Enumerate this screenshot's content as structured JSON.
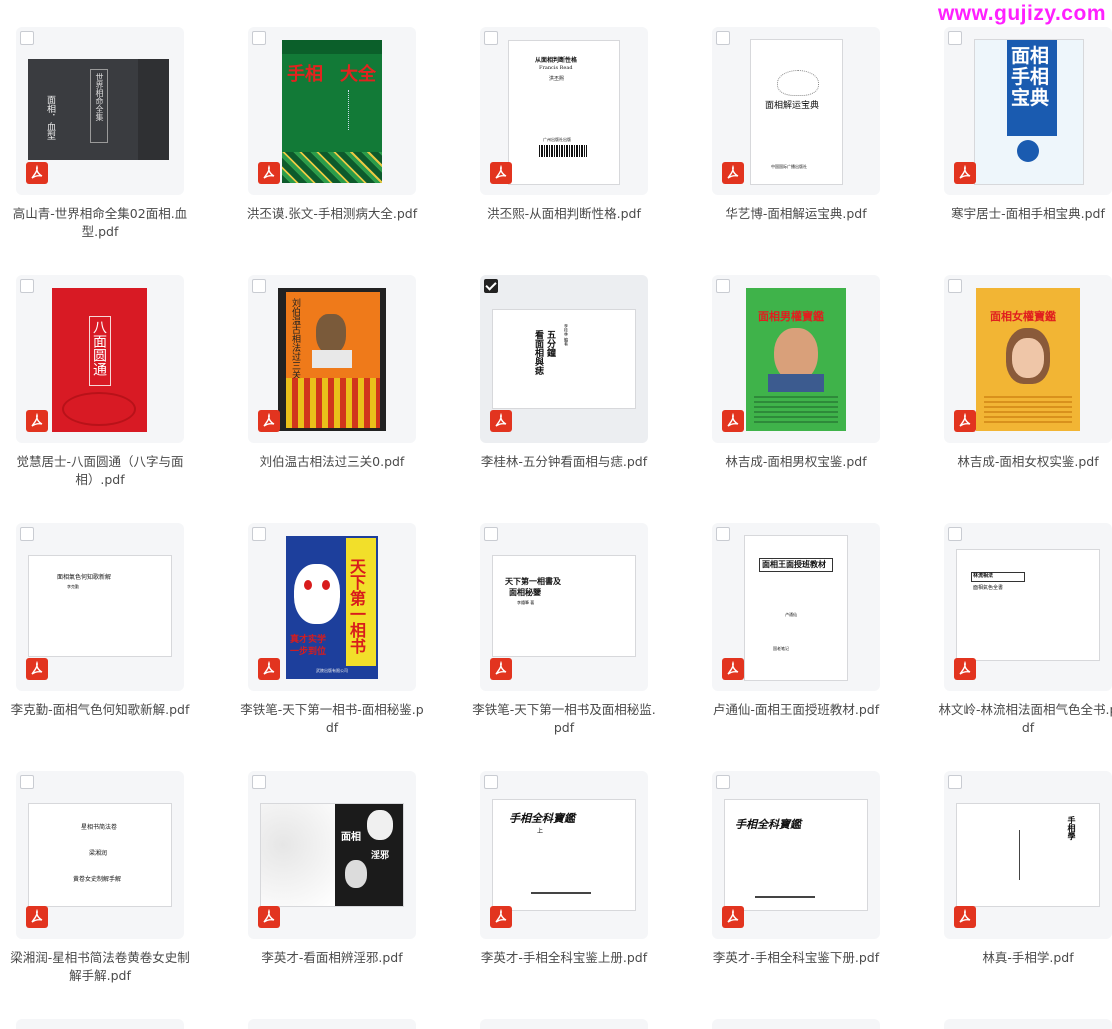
{
  "watermark": "www.gujizy.com",
  "files": [
    {
      "name": "高山青-世界相命全集02面相.血型.pdf",
      "selected": false
    },
    {
      "name": "洪丕谟.张文-手相测病大全.pdf",
      "selected": false
    },
    {
      "name": "洪丕熙-从面相判断性格.pdf",
      "selected": false
    },
    {
      "name": "华艺博-面相解运宝典.pdf",
      "selected": false
    },
    {
      "name": "寒宇居士-面相手相宝典.pdf",
      "selected": false
    },
    {
      "name": "觉慧居士-八面圆通（八字与面相）.pdf",
      "selected": false
    },
    {
      "name": "刘伯温古相法过三关0.pdf",
      "selected": false
    },
    {
      "name": "李桂林-五分钟看面相与痣.pdf",
      "selected": true
    },
    {
      "name": "林吉成-面相男权宝鉴.pdf",
      "selected": false
    },
    {
      "name": "林吉成-面相女权实鉴.pdf",
      "selected": false
    },
    {
      "name": "李克勤-面相气色何知歌新解.pdf",
      "selected": false
    },
    {
      "name": "李铁笔-天下第一相书-面相秘鉴.pdf",
      "selected": false
    },
    {
      "name": "李铁笔-天下第一相书及面相秘监.pdf",
      "selected": false
    },
    {
      "name": "卢通仙-面相王面授班教材.pdf",
      "selected": false
    },
    {
      "name": "林文岭-林流相法面相气色全书.pdf",
      "selected": false
    },
    {
      "name": "梁湘润-星相书简法卷黄卷女史制解手解.pdf",
      "selected": false
    },
    {
      "name": "李英才-看面相辨淫邪.pdf",
      "selected": false
    },
    {
      "name": "李英才-手相全科宝鉴上册.pdf",
      "selected": false
    },
    {
      "name": "李英才-手相全科宝鉴下册.pdf",
      "selected": false
    },
    {
      "name": "林真-手相学.pdf",
      "selected": false
    }
  ],
  "cover_text": {
    "c1": [
      "世界相命全集",
      "面相．血型"
    ],
    "c2": [
      "手相",
      "大全"
    ],
    "c3": [
      "从面相判断性格",
      "Francis Read",
      "洪丕熙",
      "广州出版社出版"
    ],
    "c4": [
      "面相解运宝典",
      "中国国际广播出版社"
    ],
    "c5": [
      "面相",
      "手相",
      "宝典"
    ],
    "c6": [
      "八面圆通"
    ],
    "c7": [
      "刘伯温古相法过三关"
    ],
    "c8": [
      "五分鐘",
      "看面相與痣",
      "李桂林 編著"
    ],
    "c9": [
      "面相男權寶鑑"
    ],
    "c10": [
      "面相女權寶鑑"
    ],
    "c11": [
      "面相氣色何知歌新解",
      "李克勤"
    ],
    "c12": [
      "天下第一相书",
      "真才实学",
      "一步到位",
      "武陵出版有限公司"
    ],
    "c13": [
      "天下第一相書及",
      "面相秘鑒",
      "李鐵筆 著"
    ],
    "c14": [
      "面相王面授班教材",
      "卢通仙",
      "国老笔记"
    ],
    "c15": [
      "林流相法",
      "面相氣色全書"
    ],
    "c16": [
      "星相书简法卷",
      "梁湘润",
      "黄卷女史制解手解"
    ],
    "c17": [
      "面相",
      "淫邪"
    ],
    "c18": [
      "手相全科寶鑑",
      "上"
    ],
    "c19": [
      "手相全科寶鑑"
    ],
    "c20": [
      "手相學"
    ]
  }
}
